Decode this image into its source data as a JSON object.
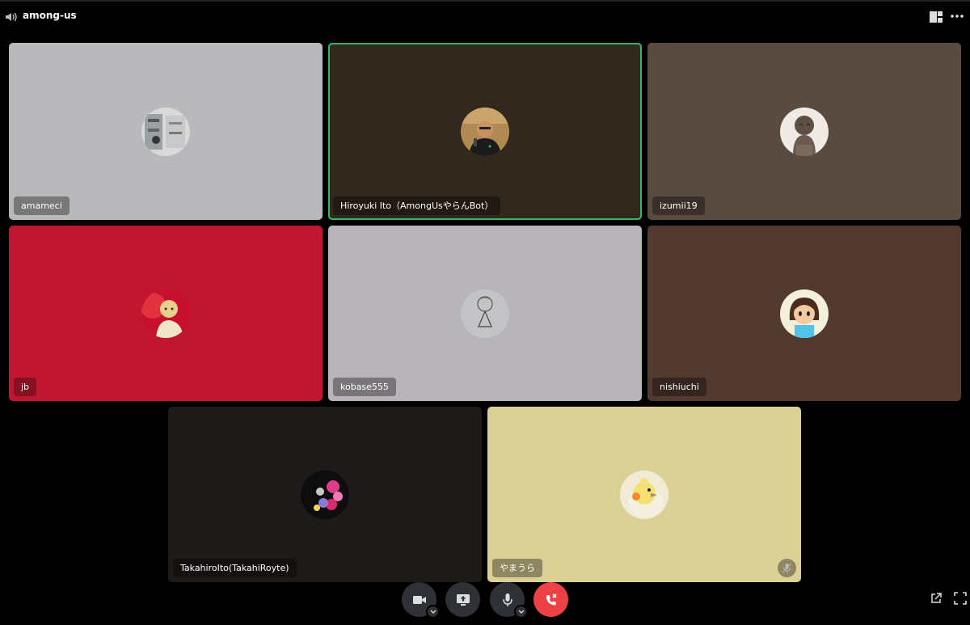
{
  "window": {
    "channel_name": "among-us",
    "speaker_icon": "speaker-icon",
    "layout_icon": "grid-layout-icon",
    "more_icon": "more-options-icon"
  },
  "participants": [
    {
      "name": "amameci",
      "bg": "#b9b9bb",
      "avatar": "photo-shelves",
      "speaking": false,
      "muted": false
    },
    {
      "name": "Hiroyuki Ito（AmongUsやらんBot）",
      "bg": "#33281d",
      "avatar": "man-with-mic",
      "speaking": true,
      "muted": false
    },
    {
      "name": "izumii19",
      "bg": "#5a4b40",
      "avatar": "buddha-statue",
      "speaking": false,
      "muted": false
    },
    {
      "name": "jb",
      "bg": "#c11631",
      "avatar": "red-portrait",
      "speaking": false,
      "muted": false
    },
    {
      "name": "kobase555",
      "bg": "#b8b5ba",
      "avatar": "line-sketch",
      "speaking": false,
      "muted": false
    },
    {
      "name": "nishiuchi",
      "bg": "#533a31",
      "avatar": "cartoon-villager",
      "speaking": false,
      "muted": false
    },
    {
      "name": "TakahiroIto(TakahiRoyte)",
      "bg": "#1f1a1a",
      "avatar": "flower-collage",
      "speaking": false,
      "muted": false
    },
    {
      "name": "やまうら",
      "bg": "#dbd095",
      "avatar": "cockatiel",
      "speaking": false,
      "muted": true
    }
  ],
  "controls": {
    "camera": "camera-icon",
    "screen_share": "screen-share-icon",
    "microphone": "microphone-icon",
    "disconnect": "disconnect-icon",
    "popout": "popout-icon",
    "fullscreen": "fullscreen-icon"
  },
  "colors": {
    "background": "#000000",
    "control_bg": "#2f3136",
    "disconnect_red": "#ed4245",
    "speaking_green": "#2fb86a"
  }
}
